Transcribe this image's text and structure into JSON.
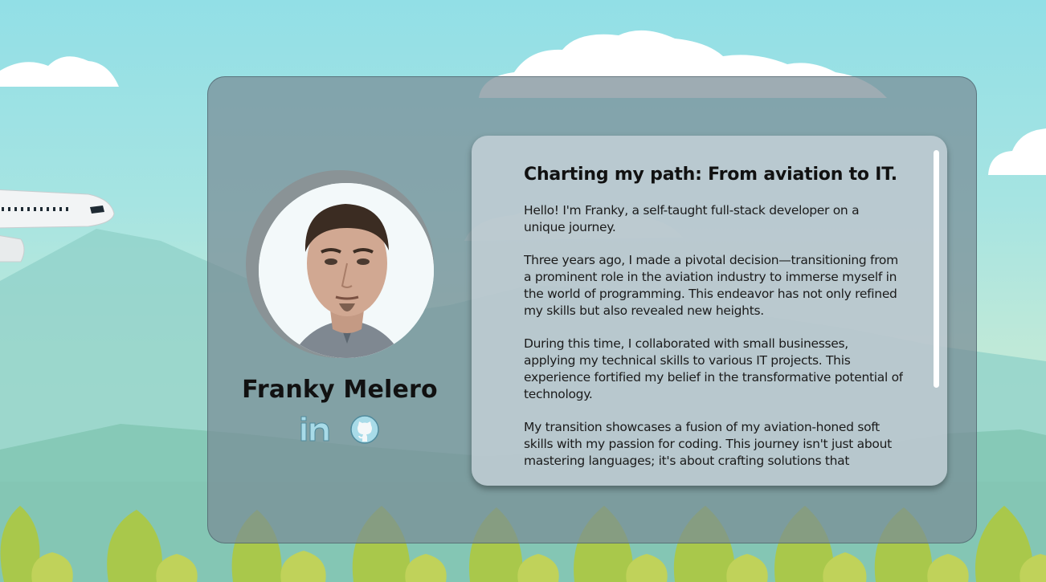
{
  "profile": {
    "name": "Franky Melero",
    "photo_alt": "Franky Melero portrait"
  },
  "socials": [
    {
      "icon": "linkedin-icon",
      "label": "in"
    },
    {
      "icon": "github-icon",
      "label": "GitHub"
    }
  ],
  "about": {
    "title": "Charting my path: From aviation to IT.",
    "paragraphs": [
      "Hello! I'm Franky, a self-taught full-stack developer on a unique journey.",
      "Three years ago, I made a pivotal decision—transitioning from a prominent role in the aviation industry to immerse myself in the world of programming. This endeavor has not only refined my skills but also revealed new heights.",
      "During this time, I collaborated with small businesses, applying my technical skills to various IT projects. This experience fortified my belief in the transformative potential of technology.",
      "My transition showcases a fusion of my aviation-honed soft skills with my passion for coding. This journey isn't just about mastering languages; it's about crafting solutions that"
    ]
  },
  "colors": {
    "sky_top": "#92dfe6",
    "card_bg": "rgba(120,140,150,0.72)",
    "panel_bg": "rgba(200,212,218,0.78)",
    "tree_green": "#a6c64a",
    "icon_blue": "#a8dbe8"
  }
}
